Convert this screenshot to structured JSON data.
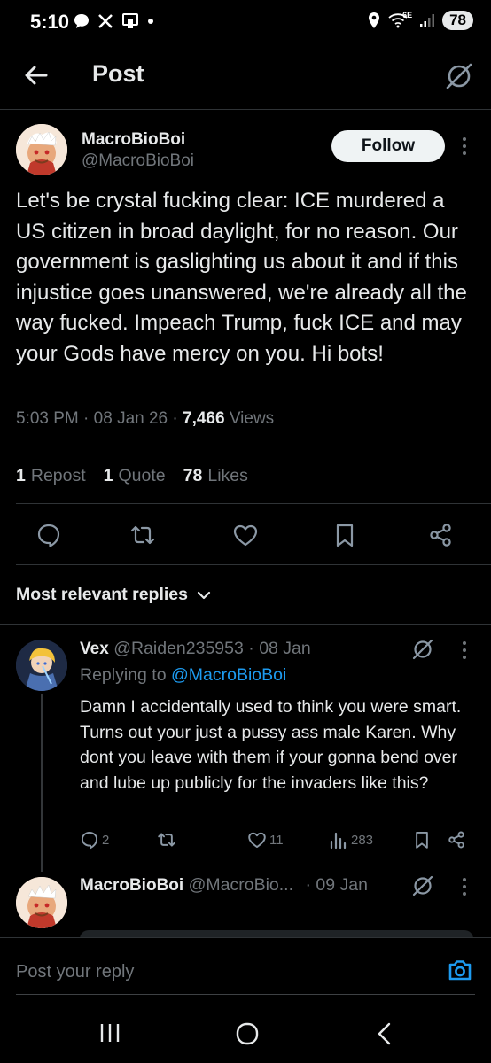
{
  "status_bar": {
    "time": "5:10",
    "network": "6E",
    "battery": "78",
    "icons": [
      "chat-bubble-icon",
      "x-logo-icon",
      "cast-icon",
      "dot-icon",
      "location-icon",
      "wifi-icon",
      "signal-icon"
    ]
  },
  "header": {
    "title": "Post",
    "back_icon": "arrow-left-icon",
    "grok_icon": "grok-icon"
  },
  "post": {
    "author_name": "MacroBioBoi",
    "author_handle": "@MacroBioBoi",
    "follow_label": "Follow",
    "text": "Let's be crystal fucking clear: ICE murdered a US citizen in broad daylight, for no reason. Our government is gaslighting us about it and if this injustice goes unanswered, we're already all the way fucked. Impeach Trump, fuck ICE and may your Gods have mercy on you. Hi bots!",
    "time": "5:03 PM",
    "date": "08 Jan 26",
    "views_count": "7,466",
    "views_label": "Views",
    "sep": "·",
    "reposts_count": "1",
    "reposts_label": "Repost",
    "quotes_count": "1",
    "quotes_label": "Quote",
    "likes_count": "78",
    "likes_label": "Likes"
  },
  "replies_filter": {
    "label": "Most relevant replies"
  },
  "reply1": {
    "name": "Vex",
    "handle": "@Raiden235953",
    "date": "· 08 Jan",
    "replying_prefix": "Replying to",
    "replying_to": "@MacroBioBoi",
    "text": "Damn I accidentally used to think you were smart. Turns out your just a pussy ass male Karen. Why dont you leave with them if your gonna bend over and lube up publicly for the invaders like this?",
    "replies": "2",
    "likes": "11",
    "views": "283"
  },
  "reply2": {
    "name": "MacroBioBoi",
    "handle": "@MacroBio...",
    "date": "· 09 Jan"
  },
  "compose": {
    "placeholder": "Post your reply"
  },
  "colors": {
    "background": "#000000",
    "text": "#e7e9ea",
    "muted": "#71767b",
    "accent": "#1d9bf0",
    "divider": "#2f3336"
  }
}
